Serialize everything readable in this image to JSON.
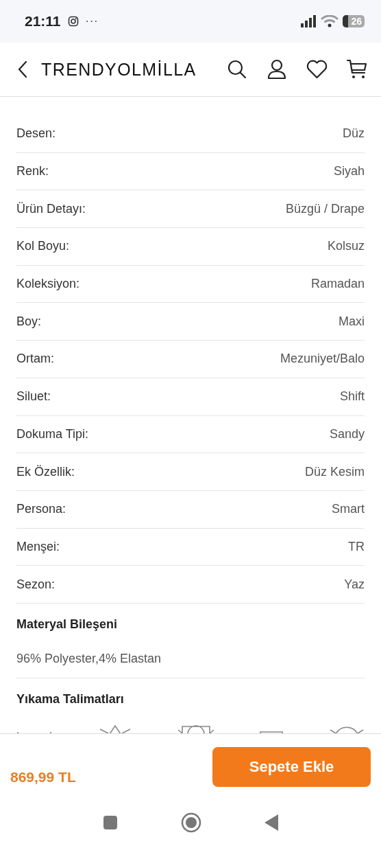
{
  "status_bar": {
    "time": "21:11",
    "overflow": "···",
    "battery": "26"
  },
  "header": {
    "brand": "TRENDYOLMİLLA"
  },
  "attributes": [
    {
      "label": "Desen:",
      "value": "Düz"
    },
    {
      "label": "Renk:",
      "value": "Siyah"
    },
    {
      "label": "Ürün Detayı:",
      "value": "Büzgü / Drape"
    },
    {
      "label": "Kol Boyu:",
      "value": "Kolsuz"
    },
    {
      "label": "Koleksiyon:",
      "value": "Ramadan"
    },
    {
      "label": "Boy:",
      "value": "Maxi"
    },
    {
      "label": "Ortam:",
      "value": "Mezuniyet/Balo"
    },
    {
      "label": "Siluet:",
      "value": "Shift"
    },
    {
      "label": "Dokuma Tipi:",
      "value": "Sandy"
    },
    {
      "label": "Ek Özellik:",
      "value": "Düz Kesim"
    },
    {
      "label": "Persona:",
      "value": "Smart"
    },
    {
      "label": "Menşei:",
      "value": "TR"
    },
    {
      "label": "Sezon:",
      "value": "Yaz"
    }
  ],
  "material": {
    "title": "Materyal Bileşeni",
    "text": "96% Polyester,4% Elastan"
  },
  "care": {
    "title": "Yıkama Talimatları"
  },
  "footer": {
    "price": "869,99 TL",
    "button": "Sepete Ekle"
  }
}
